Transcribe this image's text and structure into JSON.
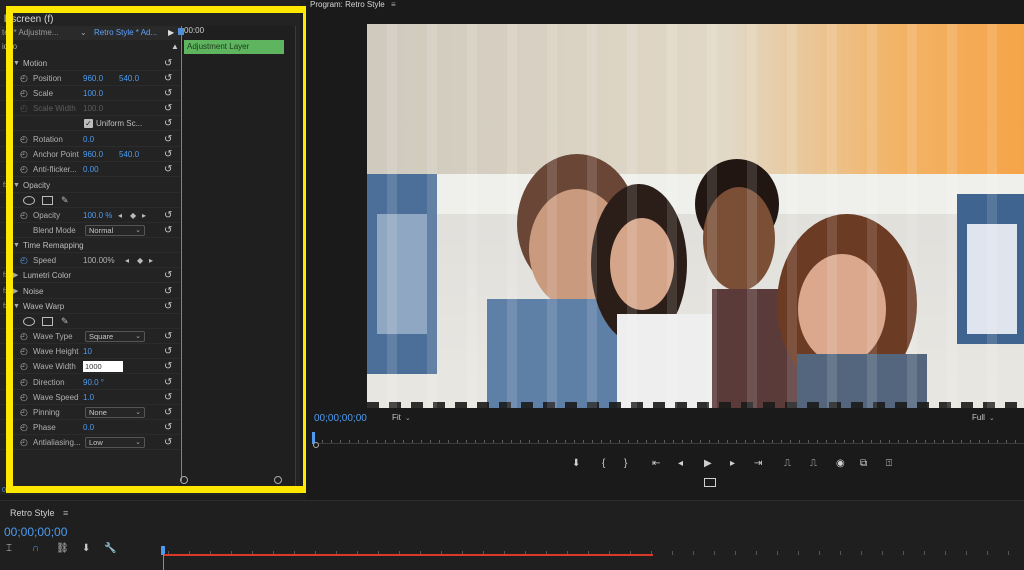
{
  "effect_controls": {
    "title": "ll screen (f)",
    "master_clip": "ter * Adjustme...",
    "sequence_clip": "Retro Style * Ad...",
    "section": "ideo",
    "timecode_small": "00:00",
    "clip_name": "Adjustment Layer",
    "bottom_timecode": "00;00;00;00",
    "rows": {
      "motion": "Motion",
      "position": {
        "label": "Position",
        "x": "960.0",
        "y": "540.0"
      },
      "scale": {
        "label": "Scale",
        "value": "100.0"
      },
      "scale_width": {
        "label": "Scale Width",
        "value": "100.0"
      },
      "uniform_scale": "Uniform Sc...",
      "rotation": {
        "label": "Rotation",
        "value": "0.0"
      },
      "anchor_point": {
        "label": "Anchor Point",
        "x": "960.0",
        "y": "540.0"
      },
      "anti_flicker": {
        "label": "Anti-flicker...",
        "value": "0.00"
      },
      "opacity_section": "Opacity",
      "opacity": {
        "label": "Opacity",
        "value": "100.0 %"
      },
      "blend_mode": {
        "label": "Blend Mode",
        "value": "Normal"
      },
      "time_remapping": "Time Remapping",
      "speed": {
        "label": "Speed",
        "value": "100.00%"
      },
      "lumetri": "Lumetri Color",
      "noise": "Noise",
      "wave_warp": "Wave Warp",
      "wave_type": {
        "label": "Wave Type",
        "value": "Square"
      },
      "wave_height": {
        "label": "Wave Height",
        "value": "10"
      },
      "wave_width": {
        "label": "Wave Width",
        "value": "1000"
      },
      "direction": {
        "label": "Direction",
        "value": "90.0 °"
      },
      "wave_speed": {
        "label": "Wave Speed",
        "value": "1.0"
      },
      "pinning": {
        "label": "Pinning",
        "value": "None"
      },
      "phase": {
        "label": "Phase",
        "value": "0.0"
      },
      "antialiasing": {
        "label": "Antialiasing...",
        "value": "Low"
      }
    }
  },
  "program_monitor": {
    "title": "Program: Retro Style",
    "timecode": "00;00;00;00",
    "fit": "Fit",
    "resolution": "Full"
  },
  "timeline": {
    "tab": "Retro Style",
    "timecode": "00;00;00;00"
  },
  "colors": {
    "highlight": "#ffe800",
    "accent_blue": "#4d9bf0",
    "clip_green": "#5fb55f",
    "work_area_red": "#d83a2a"
  },
  "icons": [
    "stopwatch-icon",
    "reset-icon",
    "ellipse-mask-icon",
    "rectangle-mask-icon",
    "pen-mask-icon",
    "keyframe-diamond-icon",
    "play-icon",
    "step-back-icon",
    "step-forward-icon",
    "export-frame-icon"
  ]
}
